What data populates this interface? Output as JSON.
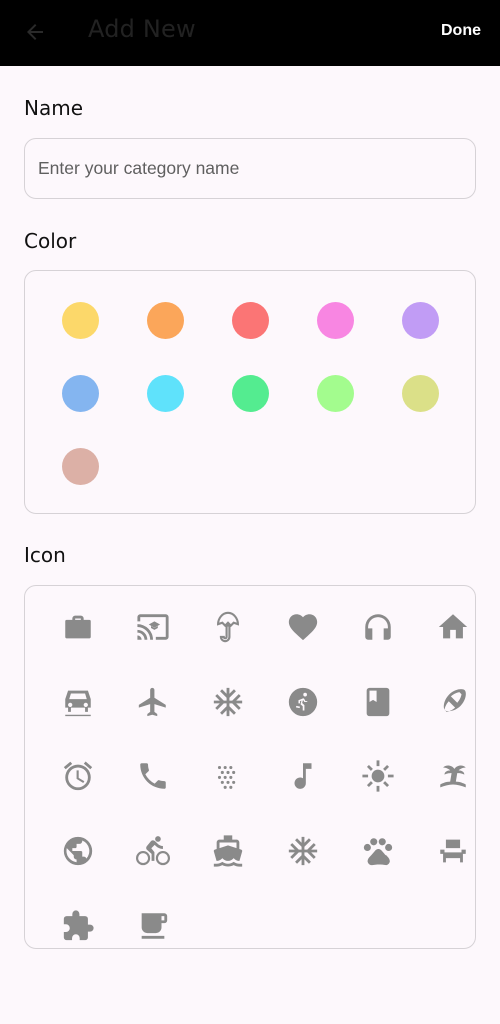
{
  "appbar": {
    "title": "Add New",
    "done_label": "Done"
  },
  "name_section": {
    "label": "Name",
    "placeholder": "Enter your category name",
    "value": ""
  },
  "color_section": {
    "label": "Color",
    "colors": [
      "#fcd86a",
      "#fba65a",
      "#fb7575",
      "#f886e2",
      "#c19cf5",
      "#84b5f0",
      "#5fe2fb",
      "#54ec90",
      "#a3fc8e",
      "#dbe088",
      "#dcb0a6"
    ]
  },
  "icon_section": {
    "label": "Icon",
    "icons": [
      "briefcase-icon",
      "cast-for-education-icon",
      "umbrella-icon",
      "heart-icon",
      "headphones-icon",
      "home-icon",
      "car-icon",
      "airplane-icon",
      "snowflake-icon",
      "running-icon",
      "book-icon",
      "football-icon",
      "alarm-icon",
      "phone-icon",
      "dots-icon",
      "music-note-icon",
      "sun-icon",
      "beach-icon",
      "globe-icon",
      "bicycle-icon",
      "boat-icon",
      "snowflake-alt-icon",
      "paw-icon",
      "chair-icon",
      "puzzle-icon",
      "coffee-icon"
    ],
    "icon_color": "#8a8a8a"
  }
}
